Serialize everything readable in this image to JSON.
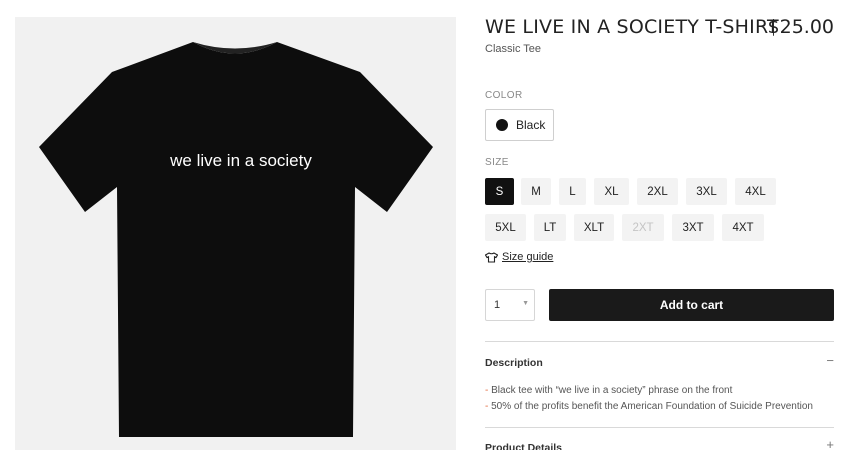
{
  "product": {
    "title": "WE LIVE IN A SOCIETY T-SHIRT",
    "price": "$25.00",
    "subtitle": "Classic Tee",
    "shirt_text": "we live in a society"
  },
  "color": {
    "label": "COLOR",
    "selected": "Black",
    "swatch_color": "#111111"
  },
  "size": {
    "label": "SIZE",
    "options": [
      "S",
      "M",
      "L",
      "XL",
      "2XL",
      "3XL",
      "4XL",
      "5XL",
      "LT",
      "XLT",
      "2XT",
      "3XT",
      "4XT"
    ],
    "selected": "S",
    "disabled": [
      "2XT"
    ],
    "guide_label": "Size guide"
  },
  "cart": {
    "quantity": "1",
    "add_label": "Add to cart"
  },
  "accordion": {
    "description_title": "Description",
    "description_toggle": "−",
    "bullet_marker": "-",
    "description_items": [
      "Black tee with “we live in a society” phrase on the front",
      "50% of the profits benefit the American Foundation of Suicide Prevention"
    ],
    "details_title": "Product Details",
    "details_toggle": "+"
  }
}
